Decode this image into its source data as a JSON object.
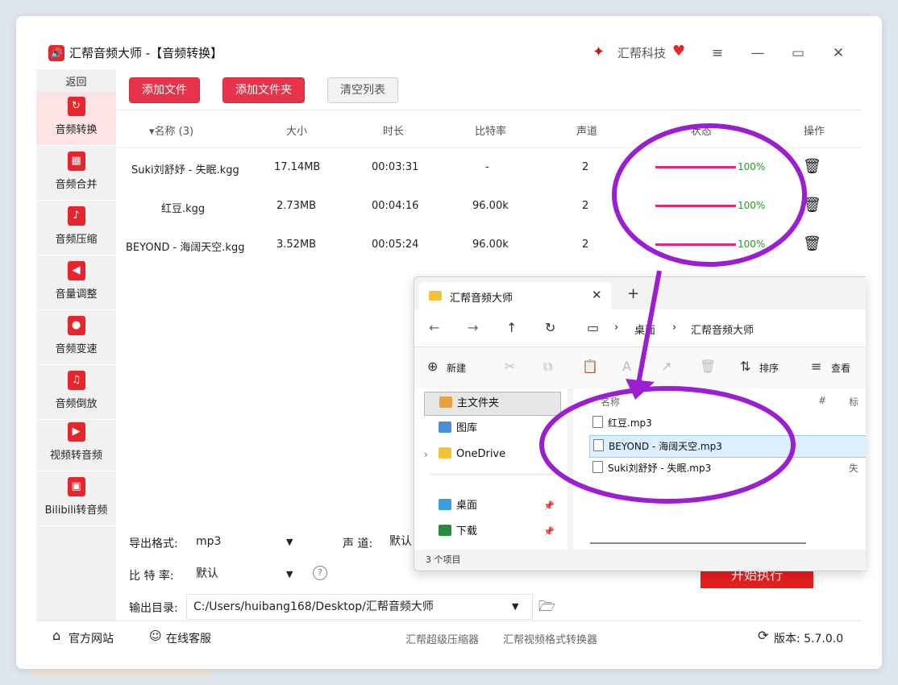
{
  "app": {
    "logo_glyph": "🔊",
    "title": "汇帮音频大师  -【音频转换】",
    "brand_glyph": "✦",
    "brand_name": "汇帮科技",
    "brand_heart": "♥"
  },
  "window_controls": {
    "menu": "≡",
    "minimize": "—",
    "maximize": "▭",
    "close": "✕"
  },
  "sidebar": {
    "back": "返回",
    "items": [
      {
        "label": "音频转换",
        "icon": "convert-icon",
        "glyph": "↻"
      },
      {
        "label": "音频合并",
        "icon": "merge-icon",
        "glyph": "▦"
      },
      {
        "label": "音频压缩",
        "icon": "compress-icon",
        "glyph": "♪"
      },
      {
        "label": "音量调整",
        "icon": "volume-icon",
        "glyph": "◀"
      },
      {
        "label": "音频变速",
        "icon": "microphone-icon",
        "glyph": "●"
      },
      {
        "label": "音频倒放",
        "icon": "music-note-icon",
        "glyph": "♫"
      },
      {
        "label": "视频转音频",
        "icon": "film-icon",
        "glyph": "▶"
      },
      {
        "label": "Bilibili转音频",
        "icon": "tv-icon",
        "glyph": "▣"
      }
    ]
  },
  "toolbar": {
    "add_file": "添加文件",
    "add_folder": "添加文件夹",
    "clear_list": "清空列表"
  },
  "table": {
    "headers": {
      "name": "▾名称 (3)",
      "size": "大小",
      "duration": "时长",
      "bitrate": "比特率",
      "channels": "声道",
      "status": "状态",
      "action": "操作"
    },
    "rows": [
      {
        "name": "Suki刘舒妤 - 失眠.kgg",
        "size": "17.14MB",
        "duration": "00:03:31",
        "bitrate": "-",
        "channels": "2",
        "progress": "100%"
      },
      {
        "name": "红豆.kgg",
        "size": "2.73MB",
        "duration": "00:04:16",
        "bitrate": "96.00k",
        "channels": "2",
        "progress": "100%"
      },
      {
        "name": "BEYOND - 海阔天空.kgg",
        "size": "3.52MB",
        "duration": "00:05:24",
        "bitrate": "96.00k",
        "channels": "2",
        "progress": "100%"
      }
    ],
    "trash_glyph": "🗑"
  },
  "settings": {
    "format_label": "导出格式:",
    "format_value": "mp3",
    "channel_label": "声 道:",
    "channel_value": "默认",
    "bitrate_label": "比 特 率:",
    "bitrate_value": "默认",
    "help_glyph": "?",
    "output_label": "输出目录:",
    "output_value": "C:/Users/huibang168/Desktop/汇帮音频大师",
    "folder_glyph": "🗁",
    "caret": "▼",
    "start_button": "开始执行"
  },
  "footer": {
    "website": "官方网站",
    "support": "在线客服",
    "link_compressor": "汇帮超级压缩器",
    "link_video": "汇帮视频格式转换器",
    "version": "版本: 5.7.0.0",
    "home_glyph": "⌂",
    "support_glyph": "☺",
    "refresh_glyph": "⟳"
  },
  "explorer": {
    "tab_title": "汇帮音频大师",
    "tab_close": "✕",
    "new_tab": "+",
    "nav": {
      "back": "←",
      "forward": "→",
      "up": "↑",
      "refresh": "↻",
      "pc": "▭",
      "sep": "›"
    },
    "breadcrumb": [
      "桌面",
      "汇帮音频大师"
    ],
    "commands": {
      "new": "新建",
      "sort": "排序",
      "view": "查看",
      "new_glyph": "⊕",
      "sort_glyph": "⇅",
      "view_glyph": "≡",
      "cut": "✂",
      "copy": "⧉",
      "paste": "📋",
      "rename": "A",
      "share": "↗",
      "delete": "🗑"
    },
    "nav_pane": [
      {
        "label": "主文件夹",
        "color": "#e9a23b",
        "expand": ""
      },
      {
        "label": "图库",
        "color": "#4b8fd6",
        "expand": ""
      },
      {
        "label": "OneDrive",
        "color": "#f3c33a",
        "expand": "›"
      },
      {
        "label": "桌面",
        "color": "#3aa0d8",
        "expand": "",
        "pin": "📌"
      },
      {
        "label": "下载",
        "color": "#2b8a3e",
        "expand": "",
        "pin": "📌"
      }
    ],
    "columns": {
      "name": "名称",
      "number": "#",
      "title": "标"
    },
    "files": [
      {
        "name": "红豆.mp3",
        "extra": ""
      },
      {
        "name": "BEYOND - 海阔天空.mp3",
        "extra": ""
      },
      {
        "name": "Suki刘舒妤 - 失眠.mp3",
        "extra": "失"
      }
    ],
    "status": "3 个项目"
  },
  "colors": {
    "accent_red": "#e5262d",
    "progress": "#e5267a",
    "annotation": "#9b1fd0"
  }
}
